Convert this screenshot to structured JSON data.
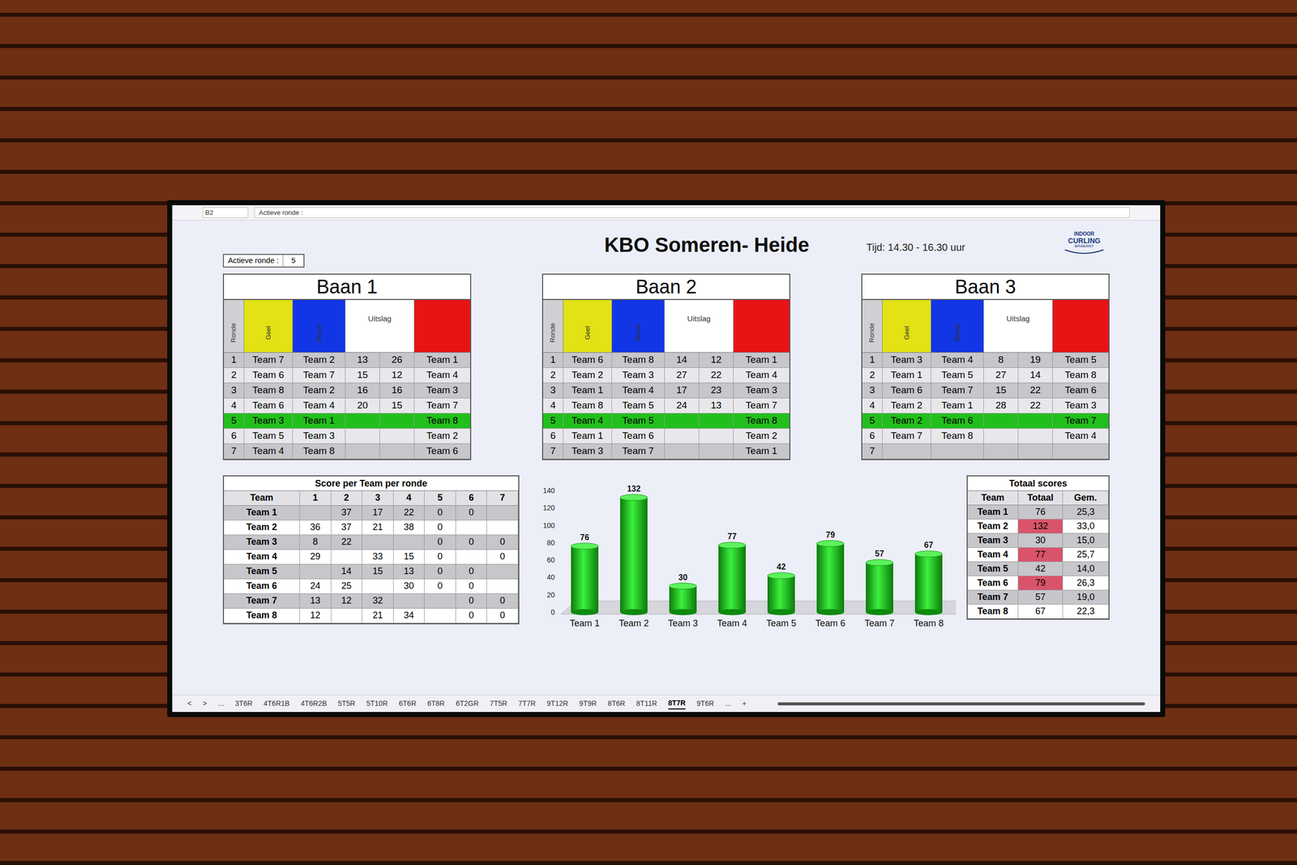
{
  "formula_bar": {
    "cell": "B2",
    "formula": "Actieve ronde :"
  },
  "title": "KBO Someren- Heide",
  "time": "Tijd: 14.30 - 16.30 uur",
  "logo": {
    "line1": "INDOOR",
    "line2": "CURLING",
    "line3": "BRABANT"
  },
  "active_round": {
    "label": "Actieve ronde :",
    "value": "5"
  },
  "lane_columns": [
    {
      "label": "Ronde",
      "color": "#d0d0d4"
    },
    {
      "label": "Geel",
      "color": "#e2e214"
    },
    {
      "label": "Blauw",
      "color": "#1236e6"
    },
    {
      "label": "Uitslag",
      "color": "#ffffff"
    },
    {
      "label": "",
      "color": "#e81414"
    }
  ],
  "lanes": [
    {
      "title": "Baan 1",
      "rows": [
        {
          "round": "1",
          "yellow": "Team 7",
          "blue": "Team 2",
          "score_yellow": "13",
          "score_blue": "26",
          "red": "Team 1",
          "selected": false
        },
        {
          "round": "2",
          "yellow": "Team 6",
          "blue": "Team 7",
          "score_yellow": "15",
          "score_blue": "12",
          "red": "Team 4",
          "selected": false
        },
        {
          "round": "3",
          "yellow": "Team 8",
          "blue": "Team 2",
          "score_yellow": "16",
          "score_blue": "16",
          "red": "Team 3",
          "selected": false
        },
        {
          "round": "4",
          "yellow": "Team 6",
          "blue": "Team 4",
          "score_yellow": "20",
          "score_blue": "15",
          "red": "Team 7",
          "selected": false
        },
        {
          "round": "5",
          "yellow": "Team 3",
          "blue": "Team 1",
          "score_yellow": "",
          "score_blue": "",
          "red": "Team 8",
          "selected": true
        },
        {
          "round": "6",
          "yellow": "Team 5",
          "blue": "Team 3",
          "score_yellow": "",
          "score_blue": "",
          "red": "Team 2",
          "selected": false
        },
        {
          "round": "7",
          "yellow": "Team 4",
          "blue": "Team 8",
          "score_yellow": "",
          "score_blue": "",
          "red": "Team 6",
          "selected": false
        }
      ]
    },
    {
      "title": "Baan 2",
      "rows": [
        {
          "round": "1",
          "yellow": "Team 6",
          "blue": "Team 8",
          "score_yellow": "14",
          "score_blue": "12",
          "red": "Team 1",
          "selected": false
        },
        {
          "round": "2",
          "yellow": "Team 2",
          "blue": "Team 3",
          "score_yellow": "27",
          "score_blue": "22",
          "red": "Team 4",
          "selected": false
        },
        {
          "round": "3",
          "yellow": "Team 1",
          "blue": "Team 4",
          "score_yellow": "17",
          "score_blue": "23",
          "red": "Team 3",
          "selected": false
        },
        {
          "round": "4",
          "yellow": "Team 8",
          "blue": "Team 5",
          "score_yellow": "24",
          "score_blue": "13",
          "red": "Team 7",
          "selected": false
        },
        {
          "round": "5",
          "yellow": "Team 4",
          "blue": "Team 5",
          "score_yellow": "",
          "score_blue": "",
          "red": "Team 8",
          "selected": true
        },
        {
          "round": "6",
          "yellow": "Team 1",
          "blue": "Team 6",
          "score_yellow": "",
          "score_blue": "",
          "red": "Team 2",
          "selected": false
        },
        {
          "round": "7",
          "yellow": "Team 3",
          "blue": "Team 7",
          "score_yellow": "",
          "score_blue": "",
          "red": "Team 1",
          "selected": false
        }
      ]
    },
    {
      "title": "Baan 3",
      "rows": [
        {
          "round": "1",
          "yellow": "Team 3",
          "blue": "Team 4",
          "score_yellow": "8",
          "score_blue": "19",
          "red": "Team 5",
          "selected": false
        },
        {
          "round": "2",
          "yellow": "Team 1",
          "blue": "Team 5",
          "score_yellow": "27",
          "score_blue": "14",
          "red": "Team 8",
          "selected": false
        },
        {
          "round": "3",
          "yellow": "Team 6",
          "blue": "Team 7",
          "score_yellow": "15",
          "score_blue": "22",
          "red": "Team 6",
          "selected": false
        },
        {
          "round": "4",
          "yellow": "Team 2",
          "blue": "Team 1",
          "score_yellow": "28",
          "score_blue": "22",
          "red": "Team 3",
          "selected": false
        },
        {
          "round": "5",
          "yellow": "Team 2",
          "blue": "Team 6",
          "score_yellow": "",
          "score_blue": "",
          "red": "Team 7",
          "selected": true
        },
        {
          "round": "6",
          "yellow": "Team 7",
          "blue": "Team 8",
          "score_yellow": "",
          "score_blue": "",
          "red": "Team 4",
          "selected": false
        },
        {
          "round": "7",
          "yellow": "",
          "blue": "",
          "score_yellow": "",
          "score_blue": "",
          "red": "",
          "selected": false
        }
      ]
    }
  ],
  "round_scores": {
    "title": "Score per Team per ronde",
    "columns": [
      "Team",
      "1",
      "2",
      "3",
      "4",
      "5",
      "6",
      "7"
    ],
    "rows": [
      [
        "Team 1",
        "",
        "37",
        "17",
        "22",
        "0",
        "0",
        ""
      ],
      [
        "Team 2",
        "36",
        "37",
        "21",
        "38",
        "0",
        "",
        ""
      ],
      [
        "Team 3",
        "8",
        "22",
        "",
        "",
        "0",
        "0",
        "0"
      ],
      [
        "Team 4",
        "29",
        "",
        "33",
        "15",
        "0",
        "",
        "0"
      ],
      [
        "Team 5",
        "",
        "14",
        "15",
        "13",
        "0",
        "0",
        ""
      ],
      [
        "Team 6",
        "24",
        "25",
        "",
        "30",
        "0",
        "0",
        ""
      ],
      [
        "Team 7",
        "13",
        "12",
        "32",
        "",
        "",
        "0",
        "0"
      ],
      [
        "Team 8",
        "12",
        "",
        "21",
        "34",
        "",
        "0",
        "0"
      ]
    ]
  },
  "chart": {
    "y_ticks": [
      "0",
      "20",
      "40",
      "60",
      "80",
      "100",
      "120",
      "140"
    ],
    "y_max": 140,
    "values": [
      76,
      132,
      30,
      77,
      42,
      79,
      57,
      67
    ],
    "value_labels": [
      "76",
      "132",
      "30",
      "77",
      "42",
      "79",
      "57",
      "67"
    ],
    "categories": [
      "Team 1",
      "Team 2",
      "Team 3",
      "Team 4",
      "Team 5",
      "Team 6",
      "Team 7",
      "Team 8"
    ]
  },
  "totals": {
    "title": "Totaal scores",
    "columns": [
      "Team",
      "Totaal",
      "Gem."
    ],
    "rows": [
      {
        "team": "Team 1",
        "total": "76",
        "avg": "25,3",
        "highlighted": false
      },
      {
        "team": "Team 2",
        "total": "132",
        "avg": "33,0",
        "highlighted": true
      },
      {
        "team": "Team 3",
        "total": "30",
        "avg": "15,0",
        "highlighted": false
      },
      {
        "team": "Team 4",
        "total": "77",
        "avg": "25,7",
        "highlighted": true
      },
      {
        "team": "Team 5",
        "total": "42",
        "avg": "14,0",
        "highlighted": false
      },
      {
        "team": "Team 6",
        "total": "79",
        "avg": "26,3",
        "highlighted": true
      },
      {
        "team": "Team 7",
        "total": "57",
        "avg": "19,0",
        "highlighted": false
      },
      {
        "team": "Team 8",
        "total": "67",
        "avg": "22,3",
        "highlighted": false
      }
    ]
  },
  "sheet_nav": [
    "<",
    ">",
    "..."
  ],
  "sheet_tabs": [
    {
      "label": "3T6R",
      "selected": false
    },
    {
      "label": "4T6R1B",
      "selected": false
    },
    {
      "label": "4T6R2B",
      "selected": false
    },
    {
      "label": "5T5R",
      "selected": false
    },
    {
      "label": "5T10R",
      "selected": false
    },
    {
      "label": "6T6R",
      "selected": false
    },
    {
      "label": "6T8R",
      "selected": false
    },
    {
      "label": "6T2GR",
      "selected": false
    },
    {
      "label": "7T5R",
      "selected": false
    },
    {
      "label": "7T7R",
      "selected": false
    },
    {
      "label": "9T12R",
      "selected": false
    },
    {
      "label": "9T9R",
      "selected": false
    },
    {
      "label": "8T6R",
      "selected": false
    },
    {
      "label": "8T11R",
      "selected": false
    },
    {
      "label": "8T7R",
      "selected": true
    },
    {
      "label": "9T6R",
      "selected": false
    }
  ],
  "sheet_extra": [
    "...",
    "+"
  ]
}
